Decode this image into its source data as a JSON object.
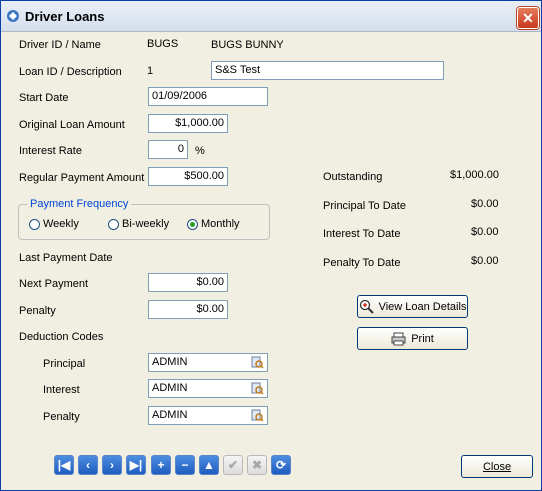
{
  "window": {
    "title": "Driver Loans",
    "close_glyph": "✕"
  },
  "labels": {
    "driver_id_name": "Driver ID / Name",
    "loan_id_description": "Loan ID / Description",
    "start_date": "Start Date",
    "original_loan_amount": "Original Loan Amount",
    "interest_rate": "Interest Rate",
    "percent_sign": "%",
    "regular_payment_amount": "Regular Payment Amount",
    "last_payment_date": "Last Payment Date",
    "next_payment": "Next Payment",
    "penalty": "Penalty",
    "deduction_codes": "Deduction Codes"
  },
  "driver": {
    "id": "BUGS",
    "name": "BUGS BUNNY"
  },
  "loan": {
    "id": "1",
    "description": "S&S Test",
    "start_date": "01/09/2006",
    "original_amount": "$1,000.00",
    "interest_rate": "0",
    "regular_payment": "$500.00",
    "next_payment": "$0.00",
    "penalty": "$0.00"
  },
  "payment_frequency": {
    "legend": "Payment Frequency",
    "options": [
      "Weekly",
      "Bi-weekly",
      "Monthly"
    ],
    "selected": "Monthly"
  },
  "deduction_codes": [
    {
      "label": "Principal",
      "value": "ADMIN"
    },
    {
      "label": "Interest",
      "value": "ADMIN"
    },
    {
      "label": "Penalty",
      "value": "ADMIN"
    }
  ],
  "summary": [
    {
      "label": "Outstanding",
      "value": "$1,000.00"
    },
    {
      "label": "Principal To Date",
      "value": "$0.00"
    },
    {
      "label": "Interest To Date",
      "value": "$0.00"
    },
    {
      "label": "Penalty To Date",
      "value": "$0.00"
    }
  ],
  "buttons": {
    "view_details": "View Loan Details",
    "print": "Print",
    "close": "Close"
  },
  "nav_buttons": [
    {
      "name": "first-record-button",
      "glyph": "|◀",
      "enabled": true
    },
    {
      "name": "prev-record-button",
      "glyph": "‹",
      "enabled": true
    },
    {
      "name": "next-record-button",
      "glyph": "›",
      "enabled": true
    },
    {
      "name": "last-record-button",
      "glyph": "▶|",
      "enabled": true
    },
    {
      "name": "add-record-button",
      "glyph": "+",
      "enabled": true
    },
    {
      "name": "delete-record-button",
      "glyph": "−",
      "enabled": true
    },
    {
      "name": "edit-record-button",
      "glyph": "▲",
      "enabled": true
    },
    {
      "name": "save-record-button",
      "glyph": "✔",
      "enabled": false
    },
    {
      "name": "cancel-record-button",
      "glyph": "✖",
      "enabled": false
    },
    {
      "name": "refresh-button",
      "glyph": "⟳",
      "enabled": true
    }
  ],
  "colors": {
    "accent": "#0046d5",
    "radio_dot": "#21a121",
    "window_bg": "#f1efe2"
  }
}
